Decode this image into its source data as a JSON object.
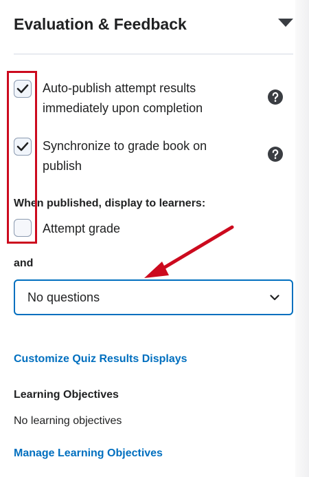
{
  "section": {
    "title": "Evaluation & Feedback"
  },
  "options": [
    {
      "label_line1": "Auto-publish attempt results",
      "label_line2": "immediately upon completion",
      "checked": true
    },
    {
      "label_line1": "Synchronize to grade book on",
      "label_line2": "publish",
      "checked": true
    }
  ],
  "display": {
    "heading": "When published, display to learners:",
    "attempt_grade_label": "Attempt grade",
    "attempt_grade_checked": false,
    "and_label": "and",
    "questions_select_value": "No questions"
  },
  "links": {
    "customize_results": "Customize Quiz Results Displays",
    "manage_objectives": "Manage Learning Objectives"
  },
  "learning_objectives": {
    "heading": "Learning Objectives",
    "empty_text": "No learning objectives"
  },
  "colors": {
    "accent": "#006fbf",
    "annotation": "#cc0a1e"
  }
}
